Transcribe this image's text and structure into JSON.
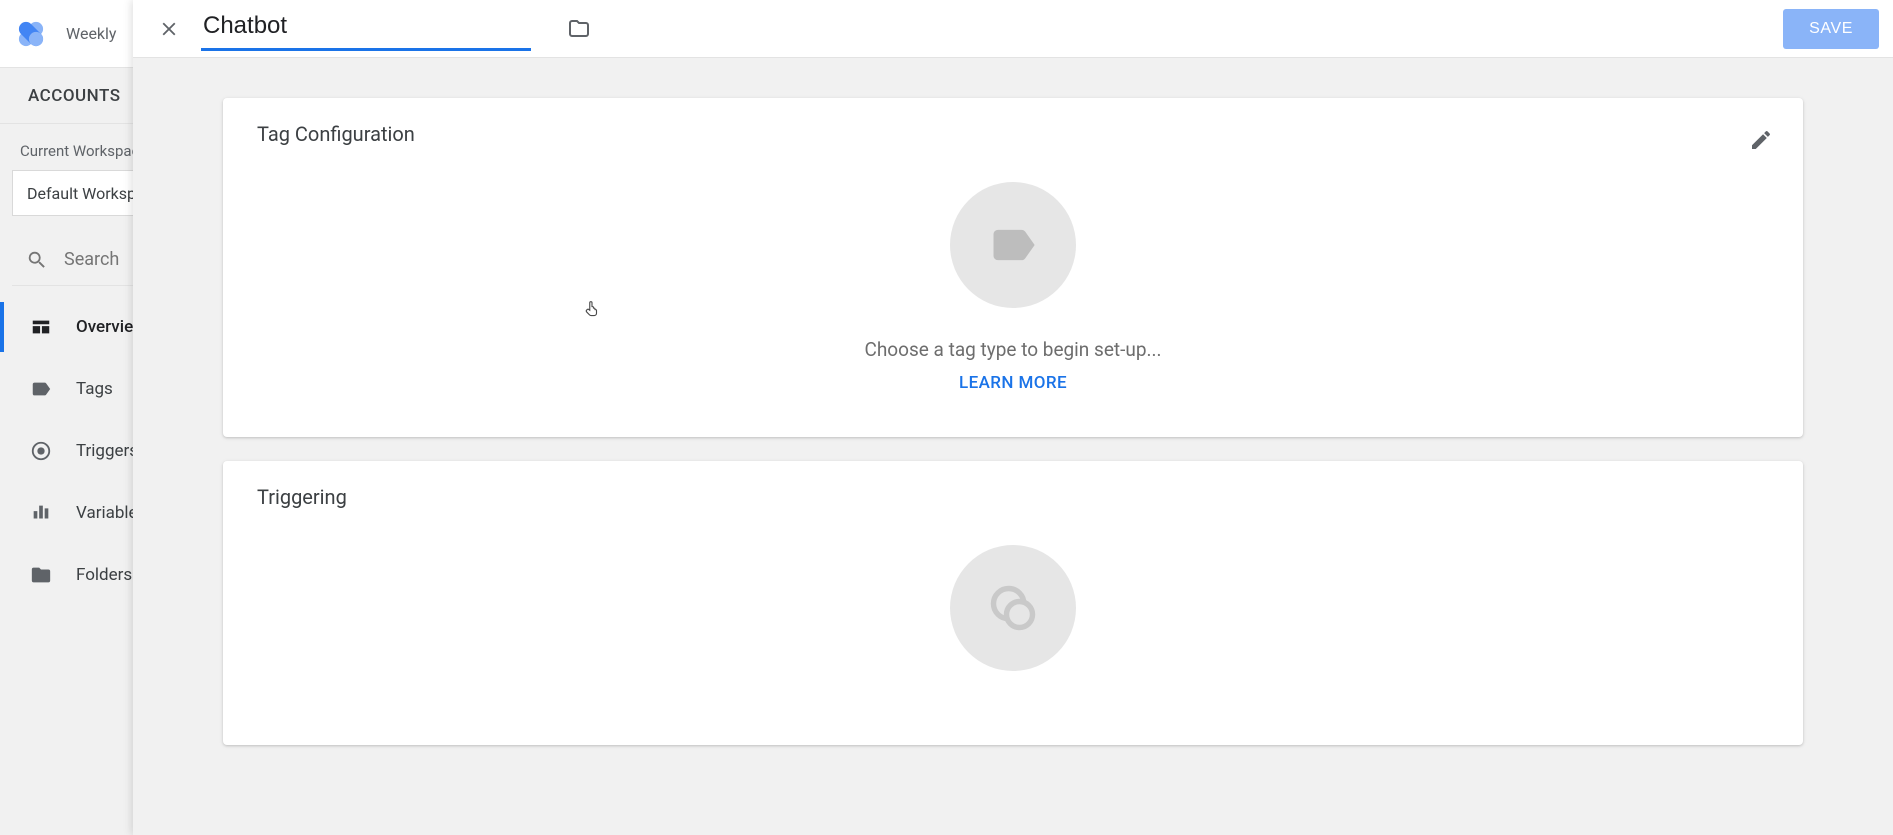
{
  "bg": {
    "topbar_title": "Weekly",
    "accounts_label": "ACCOUNTS",
    "workspace_label": "Current Workspace",
    "workspace_value": "Default Workspace",
    "search_label": "Search",
    "nav": [
      {
        "label": "Overview",
        "active": true
      },
      {
        "label": "Tags"
      },
      {
        "label": "Triggers"
      },
      {
        "label": "Variables"
      },
      {
        "label": "Folders"
      }
    ]
  },
  "panel": {
    "tag_name": "Chatbot",
    "save_label": "SAVE",
    "config_card": {
      "title": "Tag Configuration",
      "hint": "Choose a tag type to begin set-up...",
      "learn_more": "LEARN MORE"
    },
    "trigger_card": {
      "title": "Triggering"
    }
  }
}
